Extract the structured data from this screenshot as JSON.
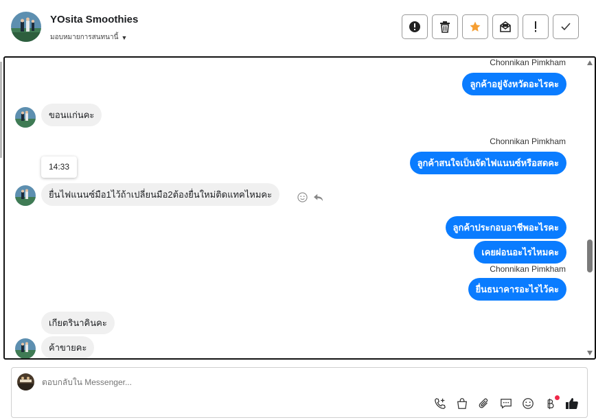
{
  "header": {
    "title": "YOsita Smoothies",
    "assign_label": "มอบหมายการสนทนานี้",
    "actions": [
      {
        "name": "report-spam",
        "icon": "exclamation-circle-icon"
      },
      {
        "name": "delete",
        "icon": "trash-icon"
      },
      {
        "name": "star",
        "icon": "star-icon"
      },
      {
        "name": "mark-unread",
        "icon": "envelope-icon"
      },
      {
        "name": "follow-up",
        "icon": "exclamation-icon"
      },
      {
        "name": "mark-done",
        "icon": "checkmark-icon"
      }
    ]
  },
  "messages": [
    {
      "sender": "Chonnikan Pimkham",
      "text": "ลูกค้าอยู่จังหวัดอะไรคะ",
      "direction": "out"
    },
    {
      "text": "ขอนแก่นคะ",
      "direction": "in"
    },
    {
      "sender": "Chonnikan Pimkham",
      "text": "ลูกค้าสนใจเป็นจัดไฟแนนซ์หรือสดคะ",
      "direction": "out"
    },
    {
      "time": "14:33"
    },
    {
      "text": "ยื่นไฟแนนซ์มือ1ไว้ถ้าเปลี่ยนมือ2ต้องยื่นใหม่ติดแทคไหมคะ",
      "direction": "in"
    },
    {
      "text": "ลูกค้าประกอบอาชีพอะไรคะ",
      "direction": "out"
    },
    {
      "text": "เคยผ่อนอะไรไหมคะ",
      "direction": "out"
    },
    {
      "sender": "Chonnikan Pimkham",
      "text": "ยื่นธนาคารอะไรไว้คะ",
      "direction": "out"
    },
    {
      "text": "เกียตรินาคินคะ",
      "direction": "in"
    },
    {
      "text": "ค้าขายคะ",
      "direction": "in"
    }
  ],
  "composer": {
    "placeholder": "ตอบกลับใน Messenger...",
    "icons": [
      "phone-plus-icon",
      "shopping-bag-icon",
      "paperclip-icon",
      "saved-reply-icon",
      "emoji-icon",
      "baht-payment-icon",
      "thumbs-up-icon"
    ]
  },
  "colors": {
    "outgoing_bubble": "#0a7cff",
    "incoming_bubble": "#f0f0f0",
    "star": "#f59e32",
    "notification_dot": "#f02849"
  }
}
